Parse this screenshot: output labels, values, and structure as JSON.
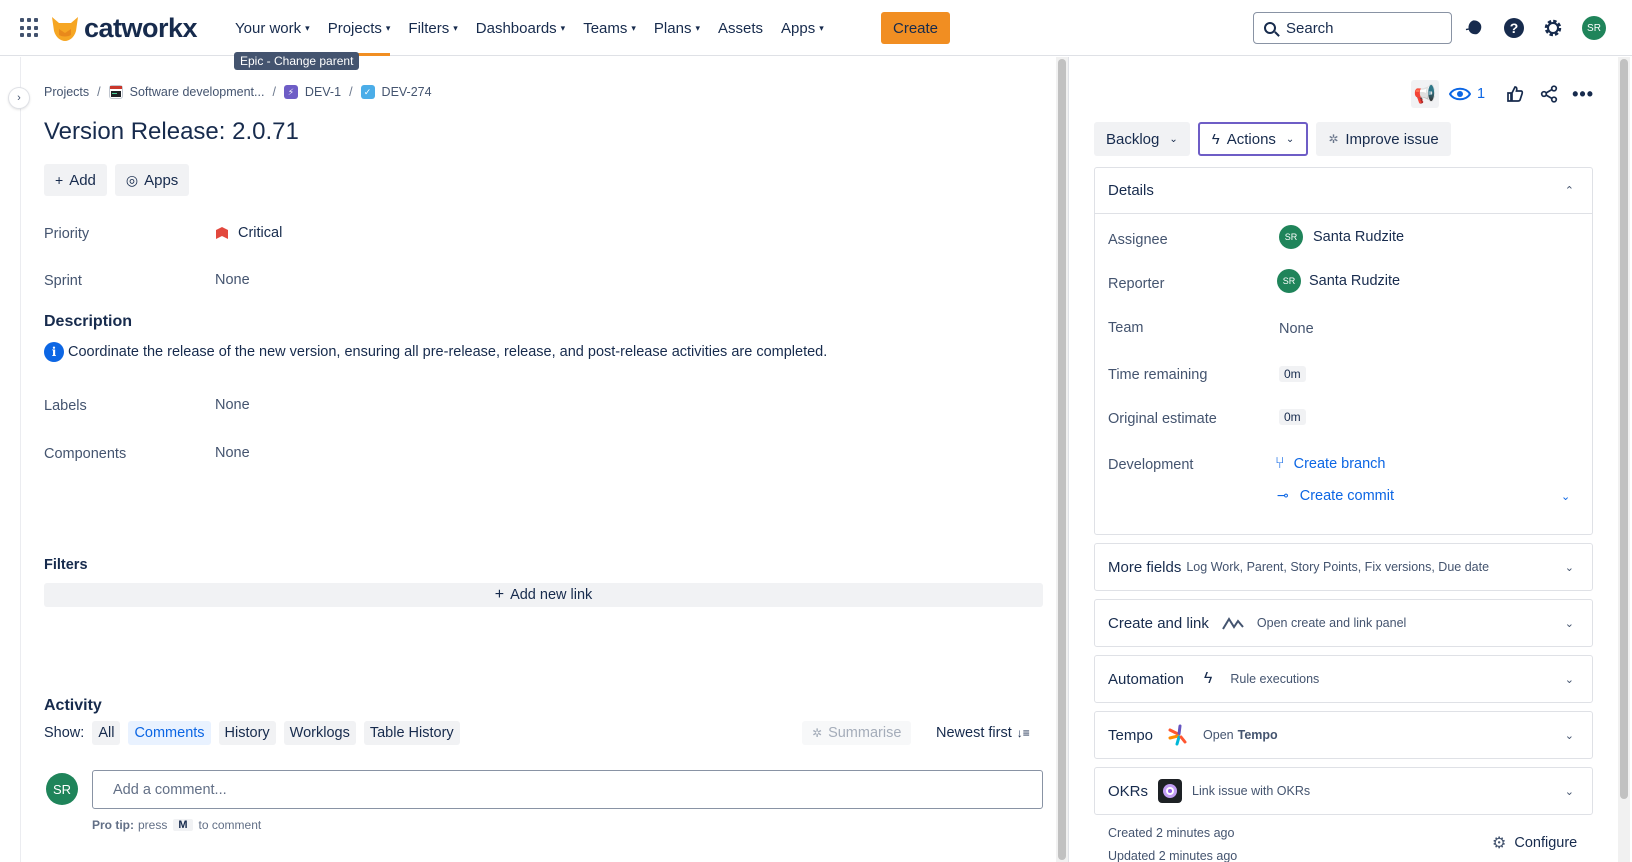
{
  "brand": {
    "name": "catworkx",
    "accent": "#f18e22"
  },
  "nav": {
    "items": [
      {
        "label": "Your work",
        "chevron": true
      },
      {
        "label": "Projects",
        "chevron": true
      },
      {
        "label": "Filters",
        "chevron": true
      },
      {
        "label": "Dashboards",
        "chevron": true
      },
      {
        "label": "Teams",
        "chevron": true
      },
      {
        "label": "Plans",
        "chevron": true
      },
      {
        "label": "Assets",
        "chevron": false
      },
      {
        "label": "Apps",
        "chevron": true
      }
    ],
    "create_label": "Create",
    "search_placeholder": "Search",
    "avatar_initials": "SR"
  },
  "tooltip": "Epic - Change parent",
  "breadcrumb": {
    "projects": "Projects",
    "project": "Software development...",
    "epic": "DEV-1",
    "issue": "DEV-274"
  },
  "issue": {
    "title": "Version Release: 2.0.71",
    "add_label": "Add",
    "apps_label": "Apps",
    "fields": {
      "priority_label": "Priority",
      "priority_value": "Critical",
      "sprint_label": "Sprint",
      "sprint_value": "None",
      "labels_label": "Labels",
      "labels_value": "None",
      "components_label": "Components",
      "components_value": "None"
    },
    "description_heading": "Description",
    "description": "Coordinate the release of the new version, ensuring all pre-release, release, and post-release activities are completed.",
    "filters_heading": "Filters",
    "add_new_link": "Add new link"
  },
  "activity": {
    "heading": "Activity",
    "show_label": "Show:",
    "filters": [
      "All",
      "Comments",
      "History",
      "Worklogs",
      "Table History"
    ],
    "selected": "Comments",
    "summarise": "Summarise",
    "sort": "Newest first",
    "comment_placeholder": "Add a comment...",
    "avatar_initials": "SR",
    "protip_prefix": "Pro tip:",
    "protip_press": "press",
    "protip_key": "M",
    "protip_suffix": "to comment"
  },
  "sidebar": {
    "watch_count": "1",
    "status": "Backlog",
    "actions": "Actions",
    "improve": "Improve issue",
    "details": {
      "heading": "Details",
      "assignee_label": "Assignee",
      "assignee_value": "Santa Rudzite",
      "reporter_label": "Reporter",
      "reporter_value": "Santa Rudzite",
      "avatar_initials": "SR",
      "team_label": "Team",
      "team_value": "None",
      "time_remaining_label": "Time remaining",
      "time_remaining_value": "0m",
      "original_estimate_label": "Original estimate",
      "original_estimate_value": "0m",
      "development_label": "Development",
      "create_branch": "Create branch",
      "create_commit": "Create commit"
    },
    "more_fields": {
      "label": "More fields",
      "sub": "Log Work, Parent, Story Points, Fix versions, Due date"
    },
    "create_link": {
      "label": "Create and link",
      "sub": "Open create and link panel"
    },
    "automation": {
      "label": "Automation",
      "sub": "Rule executions"
    },
    "tempo": {
      "label": "Tempo",
      "sub_prefix": "Open",
      "sub_bold": "Tempo"
    },
    "okrs": {
      "label": "OKRs",
      "sub": "Link issue with OKRs"
    },
    "created": "Created 2 minutes ago",
    "updated": "Updated 2 minutes ago",
    "configure": "Configure"
  }
}
